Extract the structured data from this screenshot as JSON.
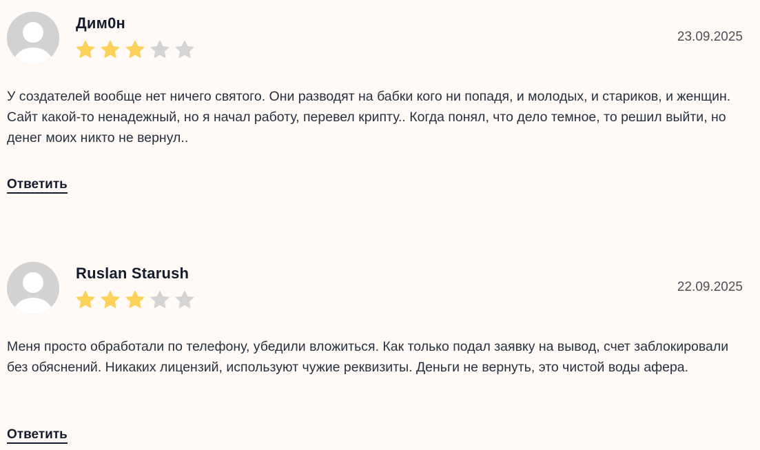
{
  "reviews": [
    {
      "author": "Дим0н",
      "date": "23.09.2025",
      "rating": 3,
      "max_rating": 5,
      "text": "У создателей вообще нет ничего святого. Они разводят на бабки кого ни попадя, и молодых, и стариков, и женщин. Сайт какой-то ненадежный, но я начал работу, перевел крипту.. Когда понял, что дело темное, то решил выйти, но денег моих никто не вернул..",
      "reply_label": "Ответить"
    },
    {
      "author": "Ruslan Starush",
      "date": "22.09.2025",
      "rating": 3,
      "max_rating": 5,
      "text": "Меня просто обработали по телефону, убедили вложиться. Как только подал заявку на вывод, счет заблокировали без обяснений. Никаких лицензий, используют чужие реквизиты. Деньги не вернуть, это чистой воды афера.",
      "reply_label": "Ответить"
    }
  ],
  "colors": {
    "background": "#fffaf5",
    "star_filled": "#fdd25b",
    "star_empty": "#d4d4d4",
    "avatar": "#d2d2d2"
  },
  "icons": {
    "avatar": "user-placeholder-icon",
    "star": "star-icon"
  }
}
